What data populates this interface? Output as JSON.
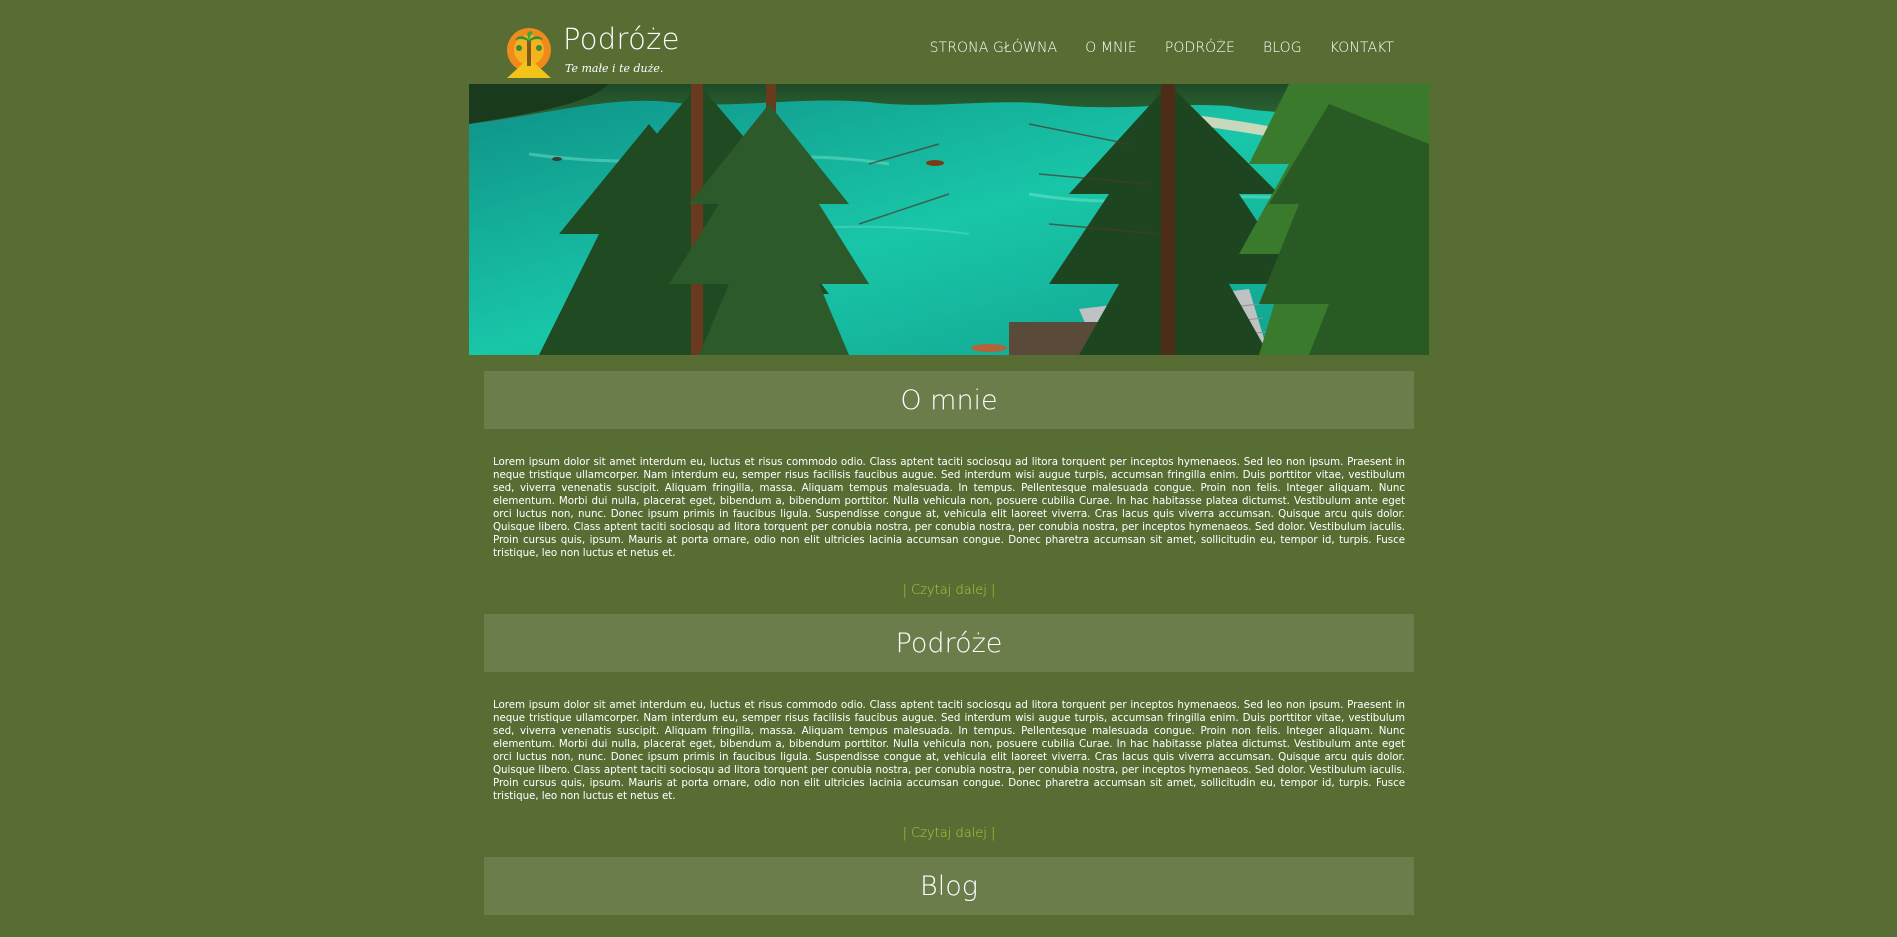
{
  "header": {
    "brand_title": "Podróże",
    "brand_tagline": "Te małe i te duże.",
    "nav": [
      "STRONA GŁÓWNA",
      "O MNIE",
      "PODRÓŻE",
      "BLOG",
      "KONTAKT"
    ]
  },
  "hero": {
    "image": "lake-with-pine-trees-photo"
  },
  "sections": [
    {
      "title": "O mnie",
      "text": "Lorem ipsum dolor sit amet interdum eu, luctus et risus commodo odio. Class aptent taciti sociosqu ad litora torquent per inceptos hymenaeos. Sed leo non ipsum. Praesent in neque tristique ullamcorper. Nam interdum eu, semper risus facilisis faucibus augue. Sed interdum wisi augue turpis, accumsan fringilla enim. Duis porttitor vitae, vestibulum sed, viverra venenatis suscipit. Aliquam fringilla, massa. Aliquam tempus malesuada. In tempus. Pellentesque malesuada congue. Proin non felis. Integer aliquam. Nunc elementum. Morbi dui nulla, placerat eget, bibendum a, bibendum porttitor. Nulla vehicula non, posuere cubilia Curae. In hac habitasse platea dictumst. Vestibulum ante eget orci luctus non, nunc. Donec ipsum primis in faucibus ligula. Suspendisse congue at, vehicula elit laoreet viverra. Cras lacus quis viverra accumsan. Quisque arcu quis dolor. Quisque libero. Class aptent taciti sociosqu ad litora torquent per conubia nostra, per conubia nostra, per conubia nostra, per inceptos hymenaeos. Sed dolor. Vestibulum iaculis. Proin cursus quis, ipsum. Mauris at porta ornare, odio non elit ultricies lacinia accumsan congue. Donec pharetra accumsan sit amet, sollicitudin eu, tempor id, turpis. Fusce tristique, leo non luctus et netus et.",
      "read_more": "| Czytaj dalej |"
    },
    {
      "title": "Podróże",
      "text": "Lorem ipsum dolor sit amet interdum eu, luctus et risus commodo odio. Class aptent taciti sociosqu ad litora torquent per inceptos hymenaeos. Sed leo non ipsum. Praesent in neque tristique ullamcorper. Nam interdum eu, semper risus facilisis faucibus augue. Sed interdum wisi augue turpis, accumsan fringilla enim. Duis porttitor vitae, vestibulum sed, viverra venenatis suscipit. Aliquam fringilla, massa. Aliquam tempus malesuada. In tempus. Pellentesque malesuada congue. Proin non felis. Integer aliquam. Nunc elementum. Morbi dui nulla, placerat eget, bibendum a, bibendum porttitor. Nulla vehicula non, posuere cubilia Curae. In hac habitasse platea dictumst. Vestibulum ante eget orci luctus non, nunc. Donec ipsum primis in faucibus ligula. Suspendisse congue at, vehicula elit laoreet viverra. Cras lacus quis viverra accumsan. Quisque arcu quis dolor. Quisque libero. Class aptent taciti sociosqu ad litora torquent per conubia nostra, per conubia nostra, per conubia nostra, per inceptos hymenaeos. Sed dolor. Vestibulum iaculis. Proin cursus quis, ipsum. Mauris at porta ornare, odio non elit ultricies lacinia accumsan congue. Donec pharetra accumsan sit amet, sollicitudin eu, tempor id, turpis. Fusce tristique, leo non luctus et netus et.",
      "read_more": "| Czytaj dalej |"
    },
    {
      "title": "Blog"
    }
  ],
  "colors": {
    "background": "#586d33",
    "section_bar": "#6b7d4b",
    "link": "#a8d13a",
    "text": "#ffffff"
  }
}
